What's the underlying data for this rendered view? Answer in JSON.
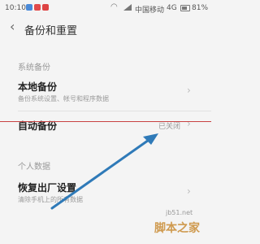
{
  "status_bar": {
    "time": "10:10",
    "carrier": "中国移动",
    "network": "4G",
    "battery_pct": "81%"
  },
  "header": {
    "title": "备份和重置"
  },
  "sections": {
    "system_backup": "系统备份",
    "personal_data": "个人数据"
  },
  "items": {
    "local_backup": {
      "label": "本地备份",
      "sub": "备份系统设置、帐号和程序数据"
    },
    "auto_backup": {
      "label": "自动备份",
      "value": "已关闭"
    },
    "factory_reset": {
      "label": "恢复出厂设置",
      "sub": "清除手机上的所有数据"
    }
  },
  "watermark": {
    "text": "脚本之家",
    "url": "jb51.net"
  },
  "colors": {
    "background": "#f4f4f4",
    "annotation_line": "#c84242",
    "annotation_arrow": "#2f7ab8"
  }
}
